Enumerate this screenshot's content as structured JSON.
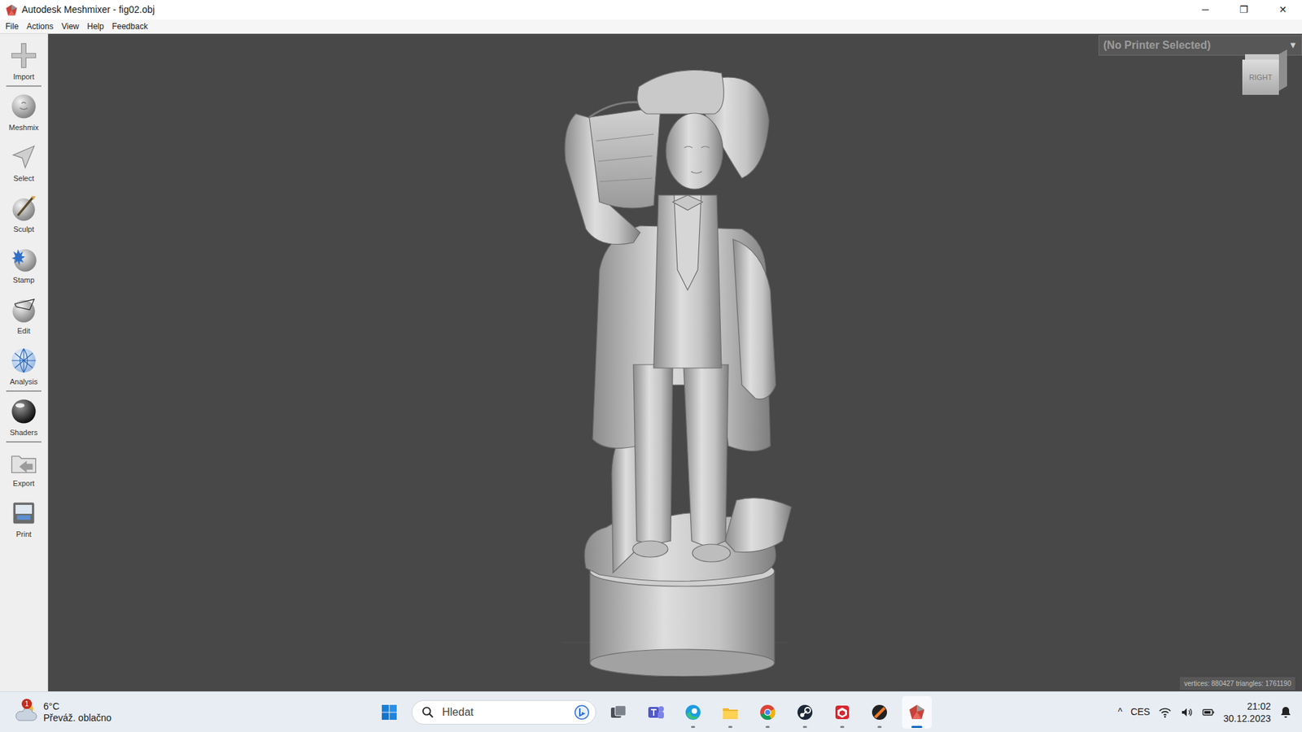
{
  "window": {
    "title": "Autodesk Meshmixer - fig02.obj",
    "controls": [
      "─",
      "❐",
      "✕"
    ]
  },
  "menu": [
    "File",
    "Actions",
    "View",
    "Help",
    "Feedback"
  ],
  "toolbar": [
    {
      "label": "Import",
      "kind": "import",
      "separator_after": true
    },
    {
      "label": "Meshmix",
      "kind": "meshmix",
      "separator_after": false
    },
    {
      "label": "Select",
      "kind": "select",
      "separator_after": false
    },
    {
      "label": "Sculpt",
      "kind": "sculpt",
      "separator_after": false
    },
    {
      "label": "Stamp",
      "kind": "stamp",
      "separator_after": false
    },
    {
      "label": "Edit",
      "kind": "edit",
      "separator_after": false
    },
    {
      "label": "Analysis",
      "kind": "analysis",
      "separator_after": true
    },
    {
      "label": "Shaders",
      "kind": "shaders",
      "separator_after": true
    },
    {
      "label": "Export",
      "kind": "export",
      "separator_after": false
    },
    {
      "label": "Print",
      "kind": "print",
      "separator_after": false
    }
  ],
  "viewport": {
    "printer": "(No Printer Selected)",
    "printer_arrow": "▼",
    "view_cube": "RIGHT",
    "status": "vertices: 880427 triangles: 1761190"
  },
  "taskbar": {
    "weather": {
      "temp": "6°C",
      "desc": "Převáž. oblačno",
      "badge": "1"
    },
    "search": {
      "placeholder": "Hledat"
    },
    "apps": [
      {
        "kind": "start",
        "running": false,
        "selected": false
      },
      {
        "kind": "search",
        "running": false,
        "selected": false
      },
      {
        "kind": "taskview",
        "running": false,
        "selected": false
      },
      {
        "kind": "teams",
        "running": false,
        "selected": false
      },
      {
        "kind": "edge",
        "running": true,
        "selected": false
      },
      {
        "kind": "explorer",
        "running": true,
        "selected": false
      },
      {
        "kind": "chrome",
        "running": true,
        "selected": false
      },
      {
        "kind": "steam",
        "running": true,
        "selected": false
      },
      {
        "kind": "redapp",
        "running": true,
        "selected": false
      },
      {
        "kind": "orangeapp",
        "running": true,
        "selected": false
      },
      {
        "kind": "meshmixer",
        "running": true,
        "selected": true
      }
    ],
    "tray": {
      "chevron": "^",
      "lang": "CES",
      "time": "21:02",
      "date": "30.12.2023"
    }
  }
}
